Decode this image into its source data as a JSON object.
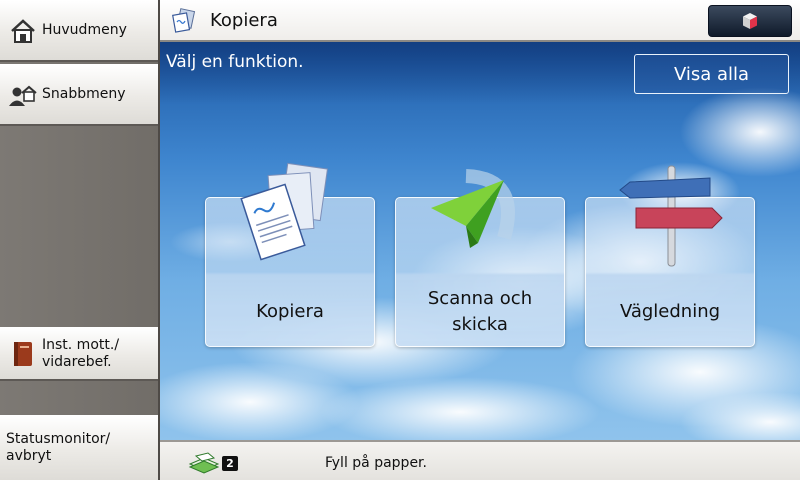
{
  "sidebar": {
    "home_label": "Huvudmeny",
    "quick_label": "Snabbmeny",
    "inbox_line1": "Inst. mott./",
    "inbox_line2": "vidarebef.",
    "status_line1": "Statusmonitor/",
    "status_line2": "avbryt"
  },
  "header": {
    "title": "Kopiera"
  },
  "main": {
    "prompt": "Välj en funktion.",
    "show_all_label": "Visa alla",
    "tiles": [
      {
        "label": "Kopiera",
        "icon": "copy-documents-icon"
      },
      {
        "label_line1": "Scanna och",
        "label_line2": "skicka",
        "icon": "paper-plane-icon"
      },
      {
        "label": "Vägledning",
        "icon": "signpost-icon"
      }
    ]
  },
  "footer": {
    "paper_count": "2",
    "message": "Fyll på papper."
  },
  "colors": {
    "sky_top": "#1d5aa6",
    "sky_bottom": "#8fc3ec",
    "sidebar": "#7d7974",
    "power_button": "#1a2536",
    "power_icon": "#e0334a"
  }
}
